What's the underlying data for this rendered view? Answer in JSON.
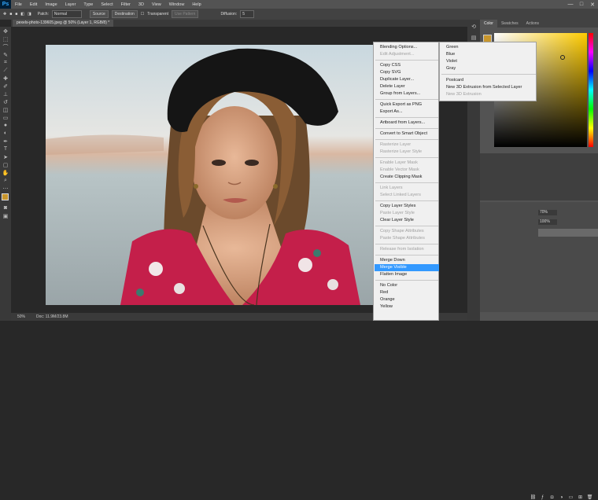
{
  "app": {
    "logo": "Ps",
    "menu": [
      "File",
      "Edit",
      "Image",
      "Layer",
      "Type",
      "Select",
      "Filter",
      "3D",
      "View",
      "Window",
      "Help"
    ],
    "window_controls": [
      "—",
      "□",
      "✕"
    ]
  },
  "options_bar": {
    "patch_label": "Patch:",
    "patch_mode": "Normal",
    "source_label": "Source",
    "destination_label": "Destination",
    "transparent_label": "Transparent",
    "use_pattern_label": "Use Pattern",
    "diffusion_label": "Diffusion:",
    "diffusion_value": "5"
  },
  "document": {
    "tab_title": "pexels-photo-139605.jpeg @ 50% (Layer 1, RGB/8) *",
    "zoom": "50%",
    "doc_size": "Doc: 11.9M/23.8M"
  },
  "panels": {
    "tabs": [
      "Color",
      "Swatches",
      "Actions"
    ],
    "layer_opacity": "70%",
    "layer_fill": "100%"
  },
  "context_menu": {
    "items": [
      {
        "label": "Blending Options...",
        "enabled": true
      },
      {
        "label": "Edit Adjustment...",
        "enabled": false
      },
      {
        "label": "Copy CSS",
        "enabled": true
      },
      {
        "label": "Copy SVG",
        "enabled": true
      },
      {
        "label": "Duplicate Layer...",
        "enabled": true
      },
      {
        "label": "Delete Layer",
        "enabled": true
      },
      {
        "label": "Group from Layers...",
        "enabled": true
      },
      {
        "label": "Quick Export as PNG",
        "enabled": true
      },
      {
        "label": "Export As...",
        "enabled": true
      },
      {
        "label": "Artboard from Layers...",
        "enabled": true
      },
      {
        "label": "Convert to Smart Object",
        "enabled": true
      },
      {
        "label": "Rasterize Layer",
        "enabled": false
      },
      {
        "label": "Rasterize Layer Style",
        "enabled": false
      },
      {
        "label": "Enable Layer Mask",
        "enabled": false
      },
      {
        "label": "Enable Vector Mask",
        "enabled": false
      },
      {
        "label": "Create Clipping Mask",
        "enabled": true
      },
      {
        "label": "Link Layers",
        "enabled": false
      },
      {
        "label": "Select Linked Layers",
        "enabled": false
      },
      {
        "label": "Copy Layer Styles",
        "enabled": true
      },
      {
        "label": "Paste Layer Style",
        "enabled": false
      },
      {
        "label": "Clear Layer Style",
        "enabled": true
      },
      {
        "label": "Copy Shape Attributes",
        "enabled": false
      },
      {
        "label": "Paste Shape Attributes",
        "enabled": false
      },
      {
        "label": "Release from Isolation",
        "enabled": false
      },
      {
        "label": "Merge Down",
        "enabled": true
      },
      {
        "label": "Merge Visible",
        "enabled": true,
        "highlighted": true
      },
      {
        "label": "Flatten Image",
        "enabled": true
      },
      {
        "label": "No Color",
        "enabled": true
      },
      {
        "label": "Red",
        "enabled": true
      },
      {
        "label": "Orange",
        "enabled": true
      },
      {
        "label": "Yellow",
        "enabled": true
      }
    ],
    "submenu": [
      {
        "label": "Green",
        "enabled": true
      },
      {
        "label": "Blue",
        "enabled": true
      },
      {
        "label": "Violet",
        "enabled": true
      },
      {
        "label": "Gray",
        "enabled": true
      },
      {
        "label": "Postcard",
        "enabled": true
      },
      {
        "label": "New 3D Extrusion from Selected Layer",
        "enabled": true
      },
      {
        "label": "New 3D Extrusion",
        "enabled": false
      }
    ]
  },
  "colors": {
    "highlight": "#3399ff",
    "foreground": "#c8962c"
  }
}
